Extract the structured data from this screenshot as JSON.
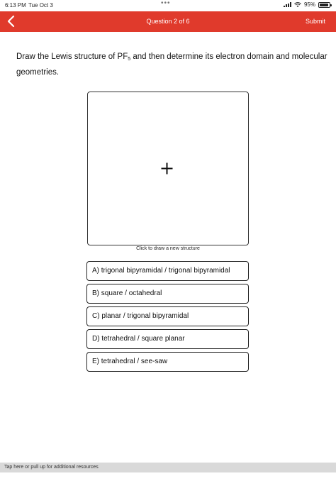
{
  "status_bar": {
    "time": "6:13 PM",
    "date": "Tue Oct 3",
    "dots": "•••",
    "battery": "95%",
    "battery_level": 0.95
  },
  "header": {
    "back_icon": "chevron-left-icon",
    "question_counter": "Question 2 of 6",
    "submit_label": "Submit",
    "background_color": "#e03a2c"
  },
  "question": {
    "text_before": "Draw the Lewis structure of PF",
    "subscript": "5",
    "text_after": " and then determine its electron domain and molecular geometries."
  },
  "drawing": {
    "plus_icon": "plus-icon",
    "caption": "Click to draw a new structure"
  },
  "options": [
    {
      "label": "A) trigonal bipyramidal / trigonal bipyramidal"
    },
    {
      "label": "B) square / octahedral"
    },
    {
      "label": "C) planar / trigonal bipyramidal"
    },
    {
      "label": "D) tetrahedral / square planar"
    },
    {
      "label": "E) tetrahedral / see-saw"
    }
  ],
  "resources_bar": {
    "label": "Tap here or pull up for additional resources"
  }
}
